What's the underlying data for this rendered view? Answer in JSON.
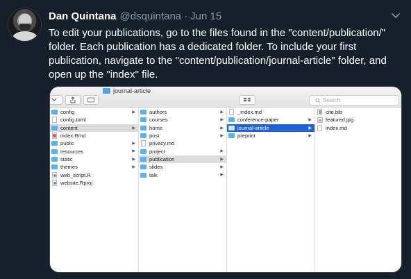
{
  "tweet": {
    "name": "Dan Quintana",
    "handle": "@dsquintana",
    "separator": "·",
    "date": "Jun 15",
    "text": "To edit your publications, go to the files found in the \"content/publication/\" folder. Each publication has a dedicated folder. To include your first publication, navigate to the \"content/publication/journal-article\" folder, and open up the \"index\" file."
  },
  "finder": {
    "window_title": "journal-article",
    "search_placeholder": "Search",
    "columns": [
      {
        "items": [
          {
            "label": "config",
            "icon": "folder-icon",
            "arrow": true,
            "selected": ""
          },
          {
            "label": "config.toml",
            "icon": "file-icon",
            "arrow": false,
            "selected": ""
          },
          {
            "label": "content",
            "icon": "folder-icon",
            "arrow": true,
            "selected": "grey"
          },
          {
            "label": "index.Rmd",
            "icon": "rmd-file-icon",
            "arrow": false,
            "selected": ""
          },
          {
            "label": "public",
            "icon": "folder-icon",
            "arrow": true,
            "selected": ""
          },
          {
            "label": "resources",
            "icon": "folder-icon",
            "arrow": true,
            "selected": ""
          },
          {
            "label": "static",
            "icon": "folder-icon",
            "arrow": true,
            "selected": ""
          },
          {
            "label": "themes",
            "icon": "folder-icon",
            "arrow": true,
            "selected": ""
          },
          {
            "label": "web_script.R",
            "icon": "r-script-icon",
            "arrow": false,
            "selected": ""
          },
          {
            "label": "website.Rproj",
            "icon": "r-script-icon",
            "arrow": false,
            "selected": ""
          }
        ]
      },
      {
        "items": [
          {
            "label": "authors",
            "icon": "folder-icon",
            "arrow": true,
            "selected": ""
          },
          {
            "label": "courses",
            "icon": "folder-icon",
            "arrow": true,
            "selected": ""
          },
          {
            "label": "home",
            "icon": "folder-icon",
            "arrow": true,
            "selected": ""
          },
          {
            "label": "post",
            "icon": "folder-icon",
            "arrow": true,
            "selected": ""
          },
          {
            "label": "privacy.md",
            "icon": "file-icon",
            "arrow": false,
            "selected": ""
          },
          {
            "label": "project",
            "icon": "folder-icon",
            "arrow": true,
            "selected": ""
          },
          {
            "label": "publication",
            "icon": "folder-icon",
            "arrow": true,
            "selected": "grey"
          },
          {
            "label": "slides",
            "icon": "folder-icon",
            "arrow": true,
            "selected": ""
          },
          {
            "label": "talk",
            "icon": "folder-icon",
            "arrow": true,
            "selected": ""
          }
        ]
      },
      {
        "items": [
          {
            "label": "_index.md",
            "icon": "file-icon",
            "arrow": false,
            "selected": ""
          },
          {
            "label": "conference-paper",
            "icon": "folder-icon",
            "arrow": true,
            "selected": ""
          },
          {
            "label": "journal-article",
            "icon": "folder-icon",
            "arrow": true,
            "selected": "blue"
          },
          {
            "label": "preprint",
            "icon": "folder-icon",
            "arrow": true,
            "selected": ""
          }
        ]
      },
      {
        "items": [
          {
            "label": "cite.bib",
            "icon": "bib-file-icon",
            "arrow": false,
            "selected": ""
          },
          {
            "label": "featured.jpg",
            "icon": "image-file-icon",
            "arrow": false,
            "selected": ""
          },
          {
            "label": "index.md",
            "icon": "file-icon",
            "arrow": false,
            "selected": ""
          }
        ]
      }
    ]
  },
  "colors": {
    "background": "#15202b",
    "secondary_text": "#8899a6",
    "selection_blue": "#1f62d6",
    "folder_blue": "#5ab0f0"
  }
}
